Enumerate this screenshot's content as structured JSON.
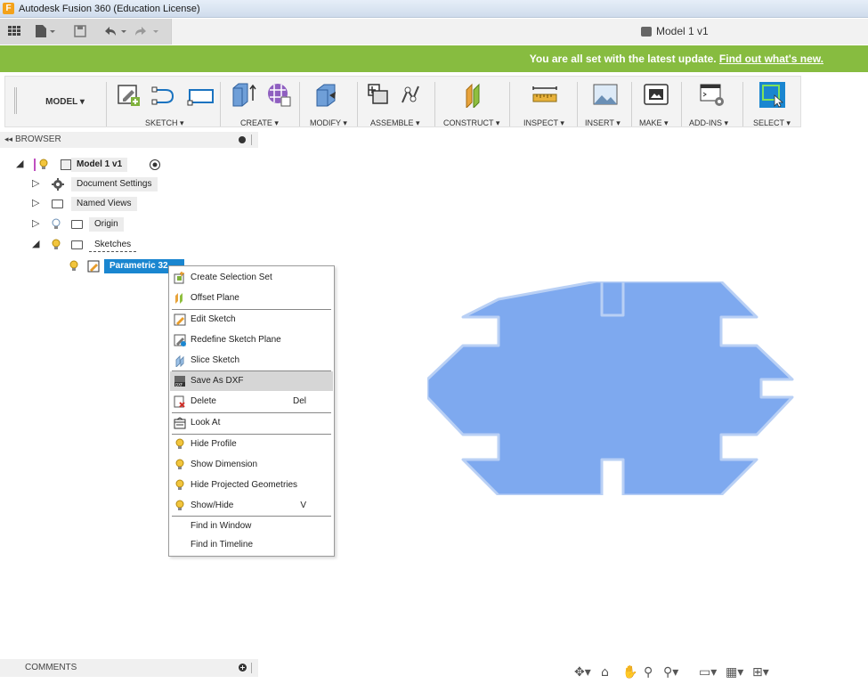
{
  "app": {
    "window_title": "Autodesk Fusion 360 (Education License)",
    "app_icon_letter": "F",
    "document_tab": "Model 1 v1"
  },
  "banner": {
    "message": "You are all set with the latest update.",
    "link": "Find out what's new."
  },
  "toolbar": {
    "workspace": "MODEL",
    "groups": [
      "SKETCH",
      "CREATE",
      "MODIFY",
      "ASSEMBLE",
      "CONSTRUCT",
      "INSPECT",
      "INSERT",
      "MAKE",
      "ADD-INS",
      "SELECT"
    ]
  },
  "browser": {
    "header": "BROWSER",
    "root": "Model 1 v1",
    "items": [
      {
        "label": "Document Settings",
        "icon": "gear-icon"
      },
      {
        "label": "Named Views",
        "icon": "folder-icon"
      },
      {
        "label": "Origin",
        "icon": "folder-icon"
      },
      {
        "label": "Sketches",
        "icon": "folder-icon"
      }
    ],
    "selected_sketch": "Parametric 32"
  },
  "context_menu": {
    "items": [
      {
        "label": "Create Selection Set",
        "icon": "selection-set-icon",
        "shortcut": ""
      },
      {
        "label": "Offset Plane",
        "icon": "offset-plane-icon",
        "shortcut": ""
      },
      {
        "label": "Edit Sketch",
        "icon": "edit-sketch-icon",
        "shortcut": ""
      },
      {
        "label": "Redefine Sketch Plane",
        "icon": "redefine-plane-icon",
        "shortcut": ""
      },
      {
        "label": "Slice Sketch",
        "icon": "slice-icon",
        "shortcut": ""
      },
      {
        "label": "Save As DXF",
        "icon": "dxf-icon",
        "shortcut": ""
      },
      {
        "label": "Delete",
        "icon": "delete-icon",
        "shortcut": "Del"
      },
      {
        "label": "Look At",
        "icon": "look-at-icon",
        "shortcut": ""
      },
      {
        "label": "Hide Profile",
        "icon": "bulb-icon",
        "shortcut": ""
      },
      {
        "label": "Show Dimension",
        "icon": "bulb-icon",
        "shortcut": ""
      },
      {
        "label": "Hide Projected Geometries",
        "icon": "bulb-icon",
        "shortcut": ""
      },
      {
        "label": "Show/Hide",
        "icon": "bulb-icon",
        "shortcut": "V"
      },
      {
        "label": "Find in Window",
        "icon": "",
        "shortcut": ""
      },
      {
        "label": "Find in Timeline",
        "icon": "",
        "shortcut": ""
      }
    ],
    "highlighted": "Save As DXF"
  },
  "comments": {
    "label": "COMMENTS"
  },
  "colors": {
    "banner": "#87bc40",
    "shape_fill": "#7ea9ef",
    "shape_stroke": "#b9d0f5",
    "select_blue": "#1a86d0",
    "sketch_selected": "#1a86d0"
  }
}
